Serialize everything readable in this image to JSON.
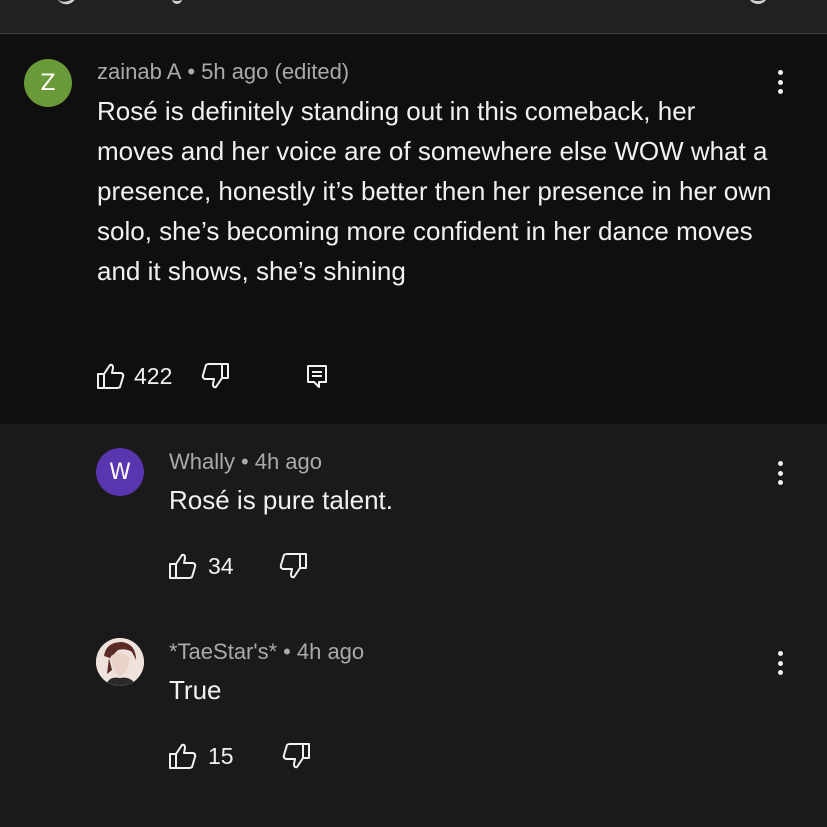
{
  "main_comment": {
    "avatar_initial": "Z",
    "avatar_color": "#6a9a3a",
    "author": "zainab A",
    "time": "5h ago",
    "edited": "(edited)",
    "text": "Rosé is definitely standing out in this comeback, her moves and her voice are of somewhere else WOW what a presence, honestly it’s better then her presence in her own solo, she’s becoming more confident in her dance moves and it shows, she’s shining",
    "likes": "422",
    "icons": [
      "thumbs-up-icon",
      "thumbs-down-icon",
      "reply-icon",
      "more-icon"
    ]
  },
  "replies": [
    {
      "avatar_initial": "W",
      "avatar_color": "#5a35b0",
      "author": "Whally",
      "time": "4h ago",
      "text": "Rosé is pure talent.",
      "likes": "34"
    },
    {
      "avatar_image": "profile-photo",
      "author": "*TaeStar's*",
      "time": "4h ago",
      "text": "True",
      "likes": "15"
    }
  ],
  "separator": "•"
}
